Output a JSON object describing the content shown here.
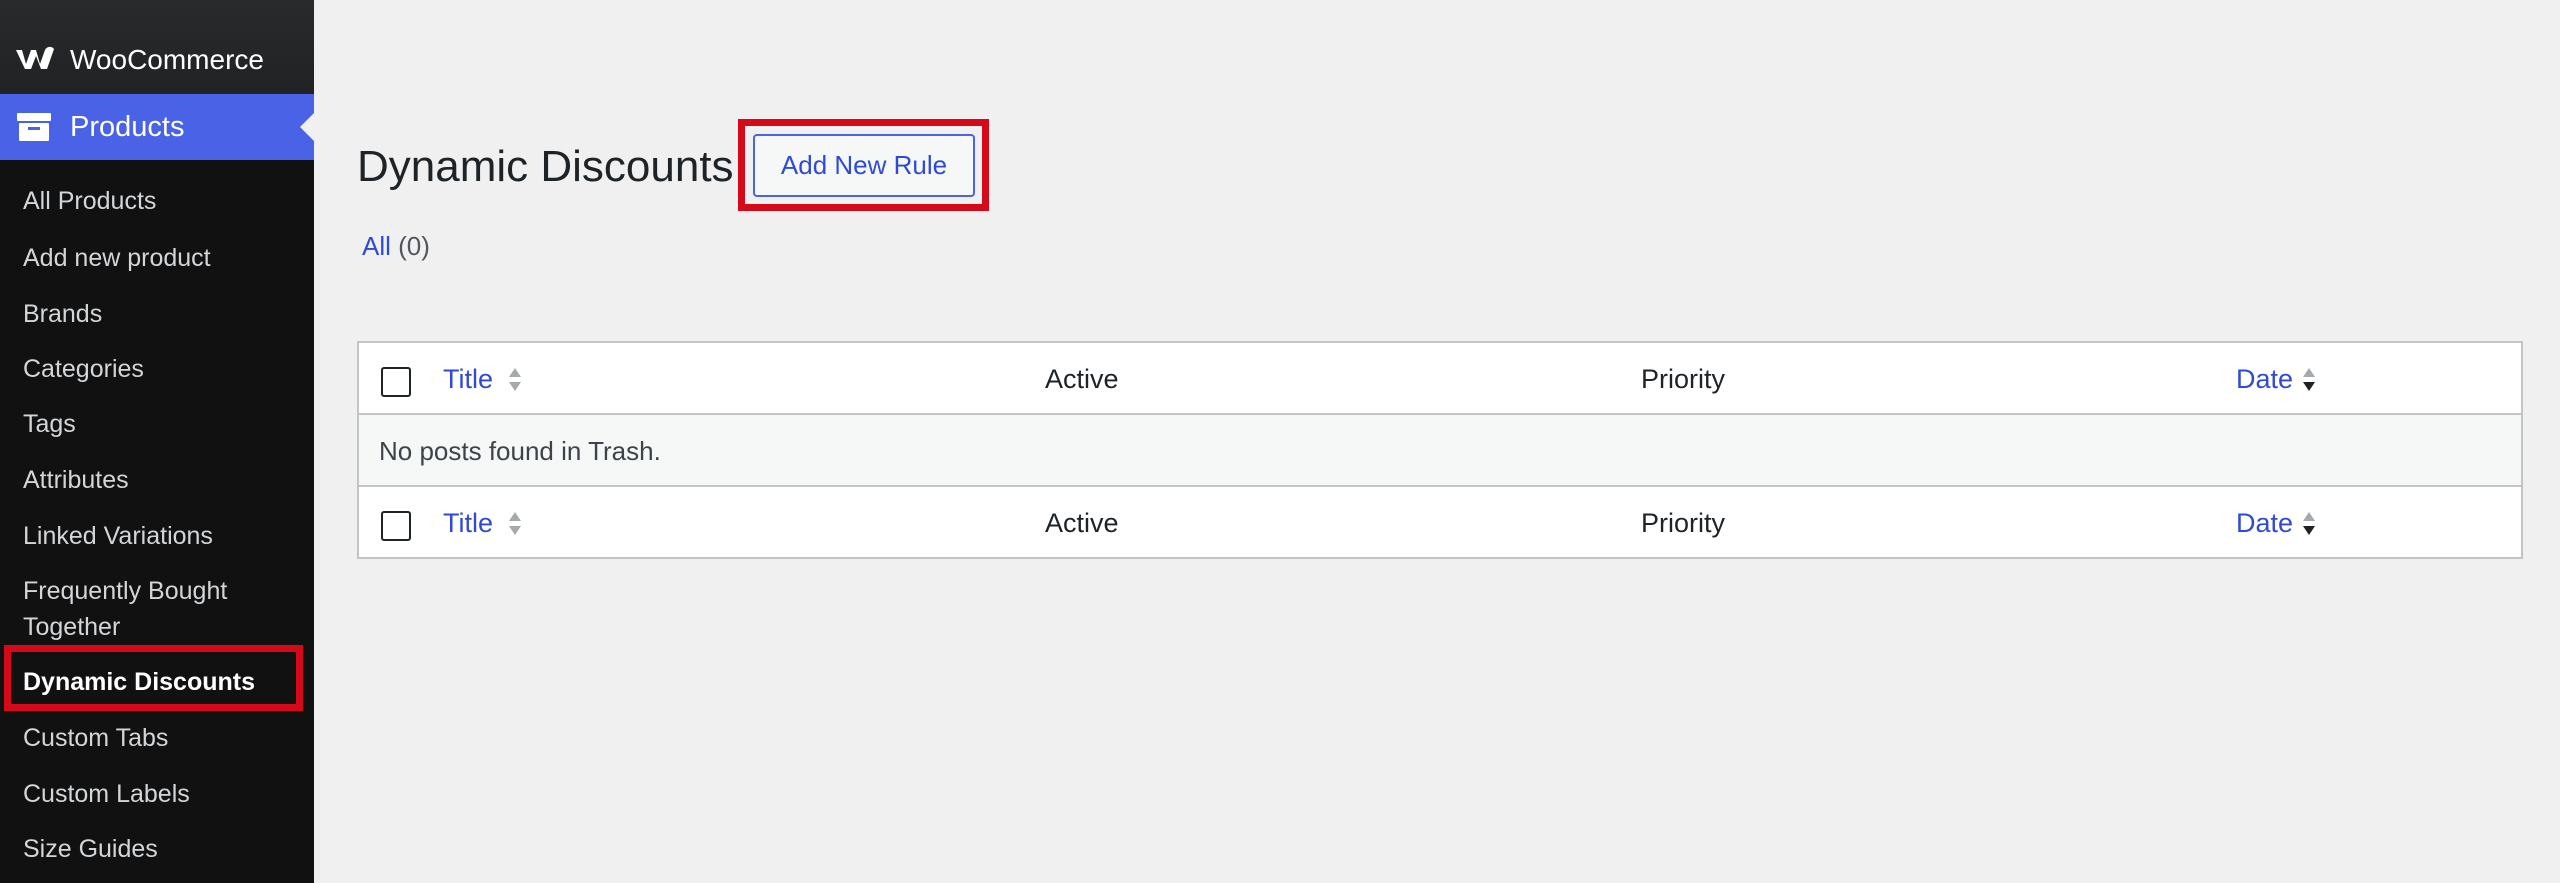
{
  "sidebar": {
    "brand": "WooCommerce",
    "section": "Products",
    "items": [
      {
        "label": "All Products"
      },
      {
        "label": "Add new product"
      },
      {
        "label": "Brands"
      },
      {
        "label": "Categories"
      },
      {
        "label": "Tags"
      },
      {
        "label": "Attributes"
      },
      {
        "label": "Linked Variations"
      },
      {
        "label": "Frequently Bought Together"
      },
      {
        "label": "Dynamic Discounts",
        "current": true
      },
      {
        "label": "Custom Tabs"
      },
      {
        "label": "Custom Labels"
      },
      {
        "label": "Size Guides"
      }
    ]
  },
  "page": {
    "title": "Dynamic Discounts",
    "add_button": "Add New Rule"
  },
  "filter": {
    "all_label": "All",
    "all_count": "(0)"
  },
  "table": {
    "columns": [
      "Title",
      "Active",
      "Priority",
      "Date"
    ],
    "empty_message": "No posts found in Trash."
  },
  "colors": {
    "accent": "#4a62e6",
    "link": "#2f4ad8",
    "highlight": "#d40a1b",
    "sidebar_bg": "#1d2327"
  }
}
